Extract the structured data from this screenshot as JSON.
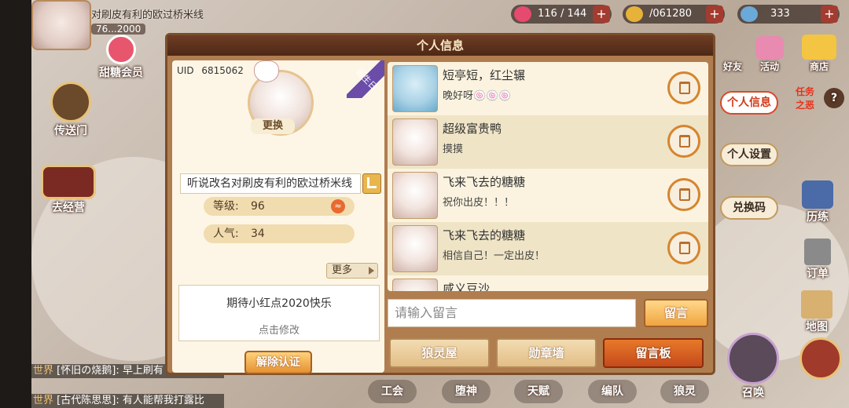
{
  "top_left": {
    "player_name": "对刷皮有利的欧过桥米线",
    "player_number": "76...2000",
    "member_label": "甜糖会员",
    "teleport_label": "传送门",
    "back_label": "去经营"
  },
  "resources": [
    {
      "value": "116 / 144",
      "icon": "heart-icon",
      "color": "#e64a6e"
    },
    {
      "value": "/061280",
      "icon": "coin-icon",
      "color": "#e6b23a"
    },
    {
      "value": "333",
      "icon": "crystal-icon",
      "color": "#6aa9d8"
    }
  ],
  "resource_plus": "+",
  "panel": {
    "title": "个人信息",
    "uid_label": "UID",
    "uid_value": "6815062",
    "change_label": "更换",
    "birthday_label": "诞生日",
    "name_value": "听说改名对刷皮有利的欧过桥米线",
    "level_label": "等级:",
    "level_value": "96",
    "popularity_label": "人气:",
    "popularity_value": "34",
    "more_label": "更多",
    "signature": "期待小红点2020快乐",
    "signature_hint": "点击修改",
    "unverify_label": "解除认证",
    "message_placeholder": "请输入留言",
    "post_label": "留言",
    "tabs": [
      "狼灵屋",
      "勋章墙",
      "留言板"
    ]
  },
  "messages": [
    {
      "name": "短亭短，红尘辗",
      "text": "晚好呀🍥🍥🍥"
    },
    {
      "name": "超级富贵鸭",
      "text": "摸摸"
    },
    {
      "name": "飞来飞去的糖糖",
      "text": "祝你出皮！！！"
    },
    {
      "name": "飞来飞去的糖糖",
      "text": "相信自己！一定出皮！"
    },
    {
      "name": "咸义豆沙",
      "text": ""
    }
  ],
  "right_menu": {
    "personal_info": "个人信息",
    "personal_settings": "个人设置",
    "redeem_code": "兑换码",
    "friend": "好友",
    "activity": "活动",
    "shop": "商店",
    "task": "任务",
    "evil": "之恶",
    "train": "历练",
    "order": "订单",
    "map": "地图",
    "summon": "召唤"
  },
  "bottom_nav": [
    "工会",
    "堕神",
    "天赋",
    "编队",
    "狼灵"
  ],
  "chat": [
    {
      "channel": "世界",
      "user": "[怀旧の烧鹅]",
      "text": ": 早上刷有"
    },
    {
      "channel": "世界",
      "user": "[古代陈思思]",
      "text": ": 有人能帮我打露比"
    }
  ]
}
